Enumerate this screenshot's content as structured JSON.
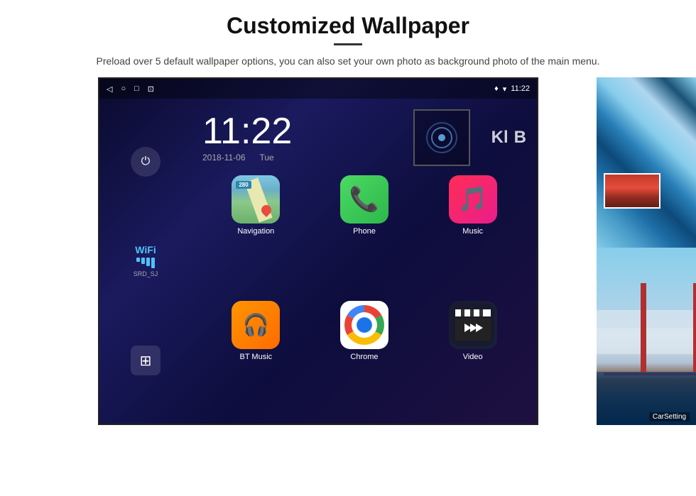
{
  "header": {
    "title": "Customized Wallpaper",
    "description": "Preload over 5 default wallpaper options, you can also set your own photo as background photo of the main menu."
  },
  "android": {
    "status_bar": {
      "time": "11:22",
      "location_icon": "♦",
      "wifi_icon": "▾"
    },
    "clock": {
      "time": "11:22",
      "date": "2018-11-06",
      "day": "Tue"
    },
    "wifi": {
      "label": "WiFi",
      "ssid": "SRD_SJ"
    },
    "apps": [
      {
        "id": "navigation",
        "label": "Navigation",
        "icon": "nav"
      },
      {
        "id": "phone",
        "label": "Phone",
        "icon": "phone"
      },
      {
        "id": "music",
        "label": "Music",
        "icon": "music"
      },
      {
        "id": "bt-music",
        "label": "BT Music",
        "icon": "bt"
      },
      {
        "id": "chrome",
        "label": "Chrome",
        "icon": "chrome"
      },
      {
        "id": "video",
        "label": "Video",
        "icon": "video"
      }
    ],
    "nav_badge": "280",
    "kl_letters": [
      "Kl",
      "B"
    ]
  },
  "overlay": {
    "carsetting_label": "CarSetting"
  },
  "buttons": {
    "power": "⏻",
    "apps_grid": "⊞"
  }
}
